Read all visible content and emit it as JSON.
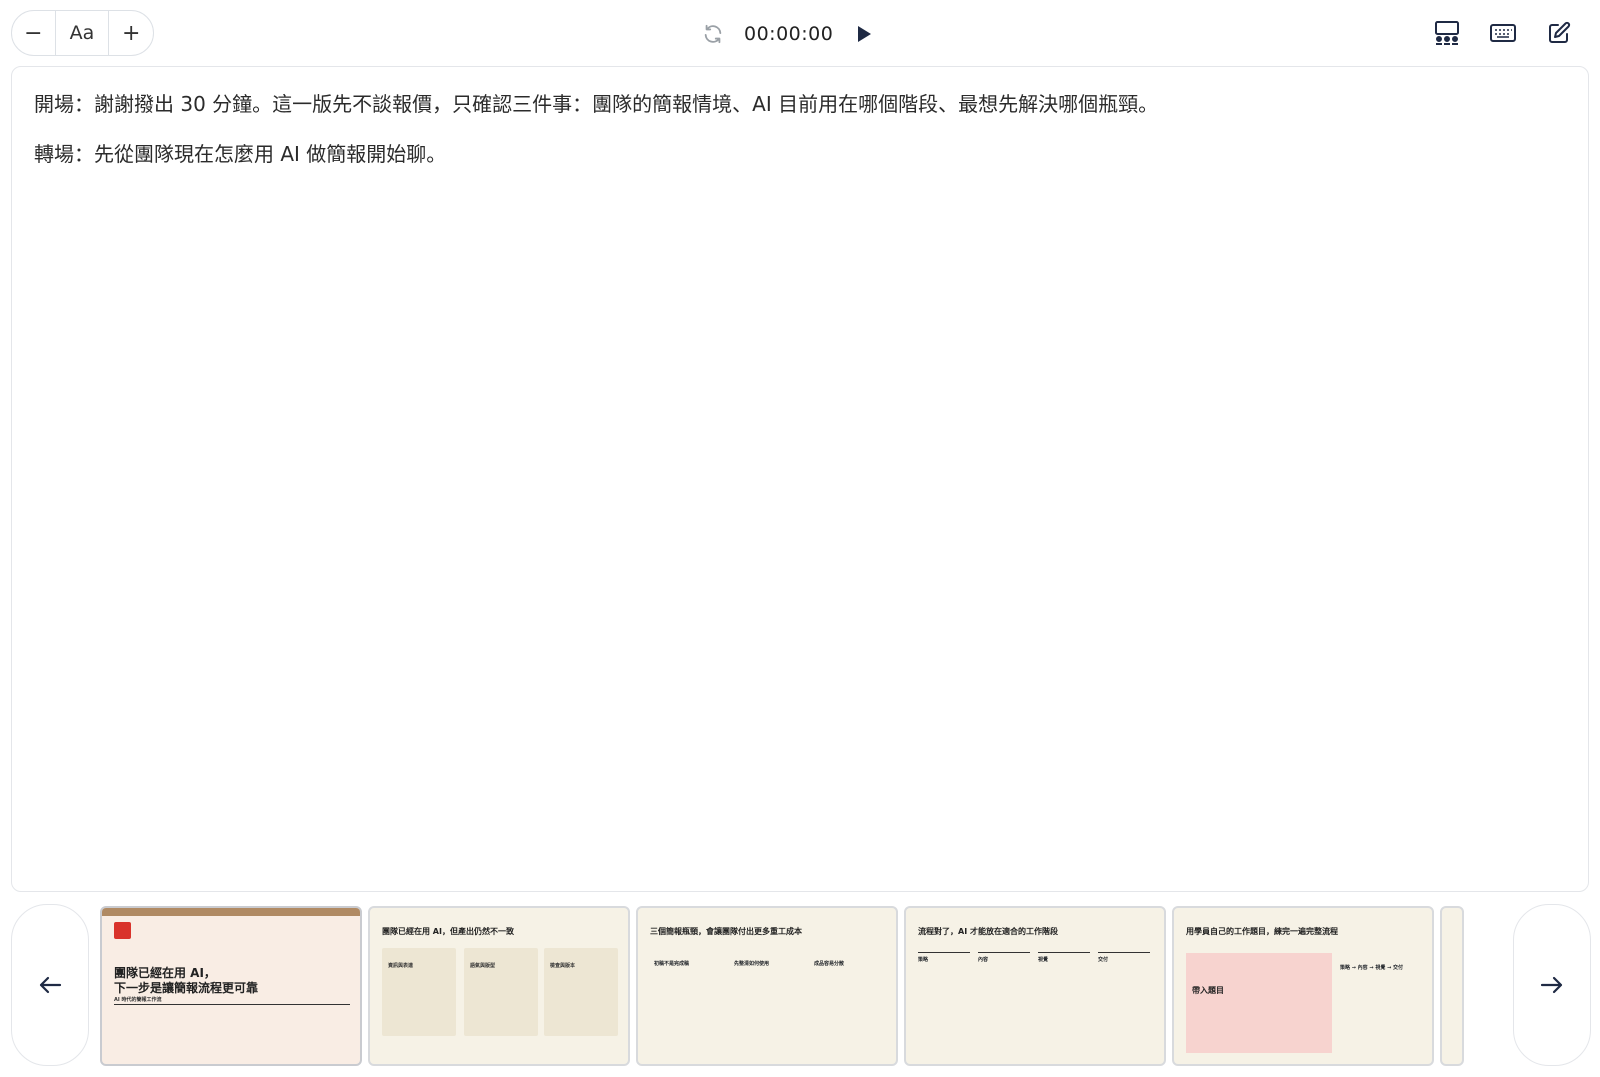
{
  "toolbar": {
    "font_decrease": "−",
    "font_label": "Aa",
    "font_increase": "+",
    "timer": "00:00:00"
  },
  "notes": {
    "lines": [
      "開場：謝謝撥出 30 分鐘。這一版先不談報價，只確認三件事：團隊的簡報情境、AI 目前用在哪個階段、最想先解決哪個瓶頸。",
      "轉場：先從團隊現在怎麼用 AI 做簡報開始聊。"
    ]
  },
  "slides": [
    {
      "title_line1": "團隊已經在用 AI，",
      "title_line2": "下一步是讓簡報流程更可靠",
      "subtitle": "AI 時代的簡報工作流"
    },
    {
      "title": "團隊已經在用 AI，但產出仍然不一致",
      "cols": [
        "資訊與表達",
        "語氣與版型",
        "檢查與版本"
      ]
    },
    {
      "title": "三個簡報瓶頸，會讓團隊付出更多重工成本",
      "cols": [
        "初稿不是完成稿",
        "先整清如何使用",
        "成品容易分散"
      ]
    },
    {
      "title": "流程對了，AI 才能放在適合的工作階段",
      "cols": [
        "策略",
        "內容",
        "視覺",
        "交付"
      ]
    },
    {
      "title": "用學員自己的工作題目，練完一遍完整流程",
      "box_label": "帶入題目",
      "flow": "策略 → 內容 → 視覺 → 交付"
    }
  ]
}
